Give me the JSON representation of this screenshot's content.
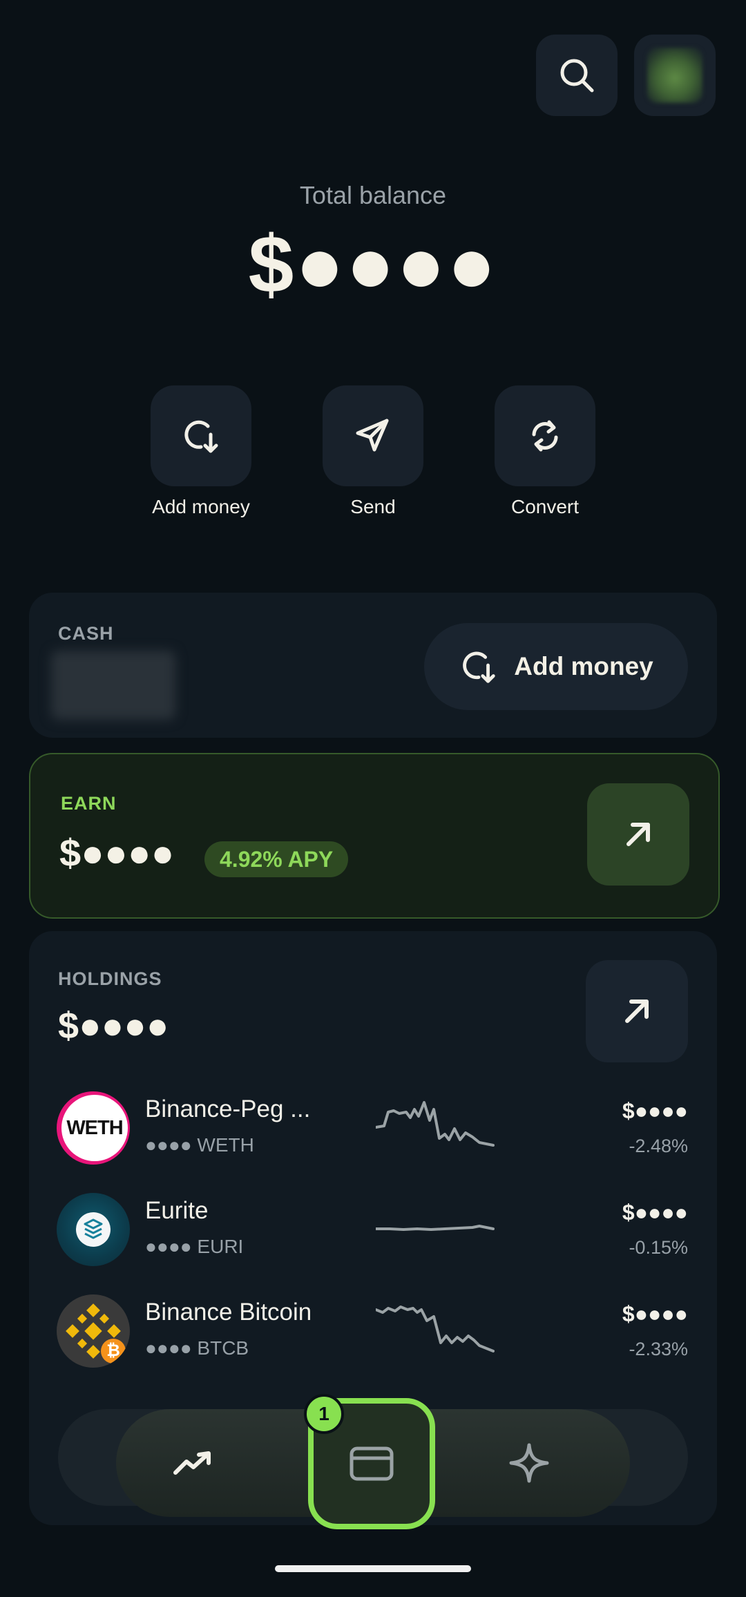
{
  "top_bar": {
    "search_icon": "search-icon",
    "avatar": "profile-avatar"
  },
  "balance": {
    "label": "Total balance",
    "value": "$●●●●"
  },
  "actions": [
    {
      "label": "Add money",
      "icon": "add-money-icon"
    },
    {
      "label": "Send",
      "icon": "send-icon"
    },
    {
      "label": "Convert",
      "icon": "convert-icon"
    }
  ],
  "cash": {
    "label": "CASH",
    "button_label": "Add money"
  },
  "earn": {
    "label": "EARN",
    "value": "$●●●●",
    "apy": "4.92% APY"
  },
  "holdings": {
    "label": "HOLDINGS",
    "value": "$●●●●",
    "items": [
      {
        "name": "Binance-Peg ...",
        "sub": "●●●● WETH",
        "price": "$●●●●",
        "change": "-2.48%",
        "logo_text": "WETH"
      },
      {
        "name": "Eurite",
        "sub": "●●●● EURI",
        "price": "$●●●●",
        "change": "-0.15%"
      },
      {
        "name": "Binance Bitcoin",
        "sub": "●●●● BTCB",
        "price": "$●●●●",
        "change": "-2.33%"
      }
    ]
  },
  "nav": {
    "badge": "1",
    "items": [
      "trending-icon",
      "card-icon",
      "sparkle-icon"
    ]
  },
  "colors": {
    "accent": "#88e050",
    "background": "#0a1116",
    "card": "#111a22"
  }
}
